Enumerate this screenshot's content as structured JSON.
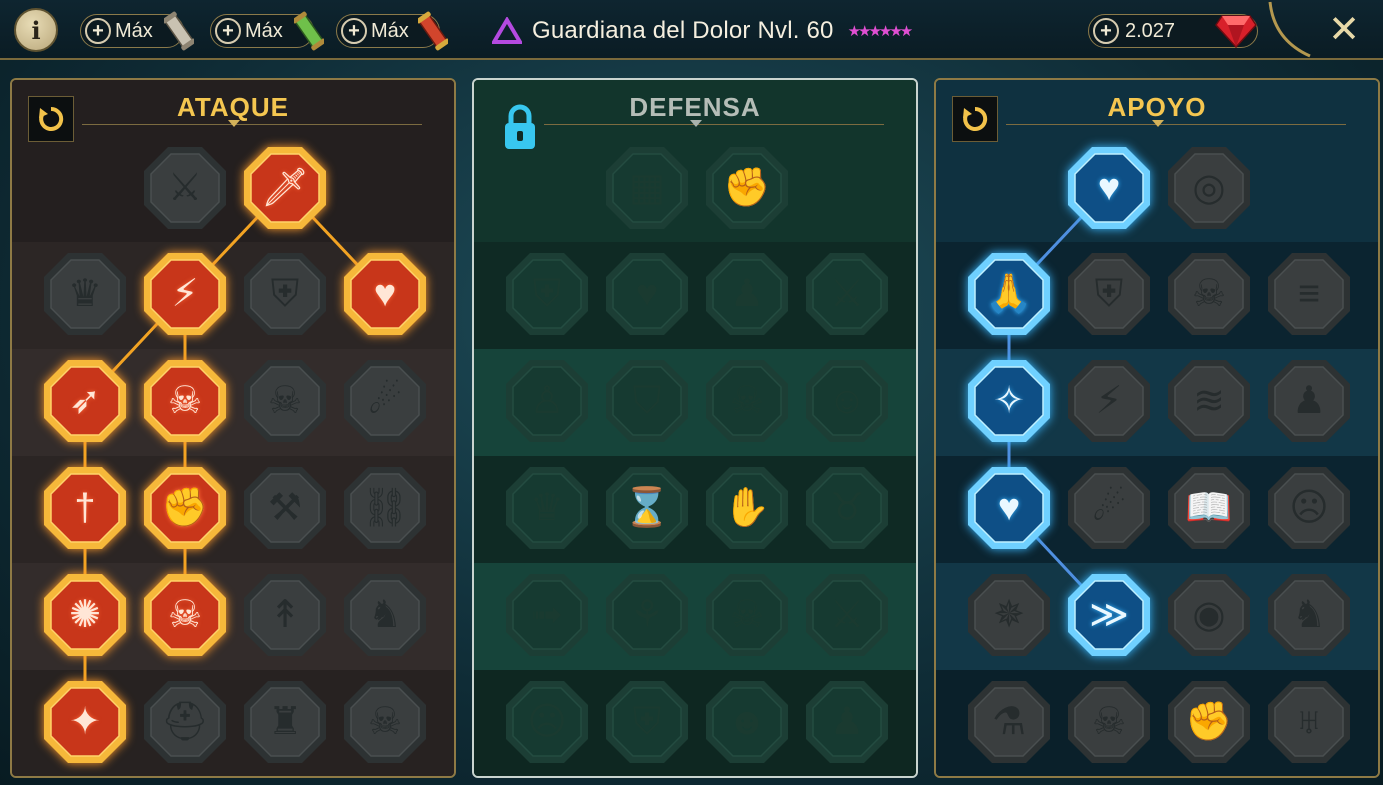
{
  "topbar": {
    "info_label": "i",
    "resources": [
      {
        "label": "Máx",
        "icon": "silver-scroll-icon"
      },
      {
        "label": "Máx",
        "icon": "green-scroll-icon"
      },
      {
        "label": "Máx",
        "icon": "red-scroll-icon"
      }
    ],
    "title": "Guardiana del Dolor Nvl. 60",
    "stars": "★★★★★★",
    "gems": "2.027",
    "close_label": "✕"
  },
  "colors": {
    "attack_accent": "#f4c650",
    "attack_active": "#d0401e",
    "support_active": "#1a8fd6",
    "stars": "#e04fd2"
  },
  "panels": {
    "attack": {
      "title": "ATAQUE",
      "nodes": [
        {
          "row": 0,
          "col": 1,
          "state": "dim",
          "glyph": "⚔",
          "icon": "crossed-swords-icon"
        },
        {
          "row": 0,
          "col": 2,
          "state": "active",
          "glyph": "🗡",
          "icon": "blade-strike-icon"
        },
        {
          "row": 1,
          "col": 0,
          "state": "dim",
          "glyph": "♛",
          "icon": "horned-demon-icon"
        },
        {
          "row": 1,
          "col": 1,
          "state": "active",
          "glyph": "⚡",
          "icon": "slash-wave-icon"
        },
        {
          "row": 1,
          "col": 2,
          "state": "dim",
          "glyph": "⛨",
          "icon": "shield-break-icon"
        },
        {
          "row": 1,
          "col": 3,
          "state": "active",
          "glyph": "♥",
          "icon": "bleeding-heart-icon"
        },
        {
          "row": 2,
          "col": 0,
          "state": "active",
          "glyph": "➶",
          "icon": "pierced-arm-icon"
        },
        {
          "row": 2,
          "col": 1,
          "state": "active",
          "glyph": "☠",
          "icon": "fanged-mouth-icon"
        },
        {
          "row": 2,
          "col": 2,
          "state": "dim",
          "glyph": "☠",
          "icon": "skull-wind-icon"
        },
        {
          "row": 2,
          "col": 3,
          "state": "dim",
          "glyph": "☄",
          "icon": "scythe-icon"
        },
        {
          "row": 3,
          "col": 0,
          "state": "active",
          "glyph": "†",
          "icon": "sword-heart-icon"
        },
        {
          "row": 3,
          "col": 1,
          "state": "active",
          "glyph": "✊",
          "icon": "fist-blade-icon"
        },
        {
          "row": 3,
          "col": 2,
          "state": "dim",
          "glyph": "⚒",
          "icon": "axe-icon"
        },
        {
          "row": 3,
          "col": 3,
          "state": "dim",
          "glyph": "⛓",
          "icon": "chain-lightning-icon"
        },
        {
          "row": 4,
          "col": 0,
          "state": "active",
          "glyph": "✺",
          "icon": "arrow-burst-icon"
        },
        {
          "row": 4,
          "col": 1,
          "state": "active",
          "glyph": "☠",
          "icon": "triple-skull-icon"
        },
        {
          "row": 4,
          "col": 2,
          "state": "dim",
          "glyph": "↟",
          "icon": "dagger-ring-icon"
        },
        {
          "row": 4,
          "col": 3,
          "state": "dim",
          "glyph": "♞",
          "icon": "raging-warrior-icon"
        },
        {
          "row": 5,
          "col": 0,
          "state": "active",
          "glyph": "✦",
          "icon": "sword-sparkle-icon"
        },
        {
          "row": 5,
          "col": 1,
          "state": "dim",
          "glyph": "⛑",
          "icon": "knight-helm-icon"
        },
        {
          "row": 5,
          "col": 2,
          "state": "dim",
          "glyph": "♜",
          "icon": "horned-beast-icon"
        },
        {
          "row": 5,
          "col": 3,
          "state": "dim",
          "glyph": "☠",
          "icon": "skull-sword-icon"
        }
      ]
    },
    "defense": {
      "title": "DEFENSA",
      "nodes": [
        {
          "row": 0,
          "col": 1,
          "state": "dim",
          "glyph": "▦",
          "icon": "armor-plates-icon"
        },
        {
          "row": 0,
          "col": 2,
          "state": "dim",
          "glyph": "✊",
          "icon": "raised-fist-icon"
        },
        {
          "row": 1,
          "col": 0,
          "state": "dim",
          "glyph": "⛨",
          "icon": "chest-shield-icon"
        },
        {
          "row": 1,
          "col": 1,
          "state": "dim",
          "glyph": "♥",
          "icon": "heart-arrow-icon"
        },
        {
          "row": 1,
          "col": 2,
          "state": "dim",
          "glyph": "♟",
          "icon": "muscled-body-icon"
        },
        {
          "row": 1,
          "col": 3,
          "state": "dim",
          "glyph": "⚔",
          "icon": "crossed-blades-icon"
        },
        {
          "row": 2,
          "col": 0,
          "state": "dim",
          "glyph": "♙",
          "icon": "dodging-figure-icon"
        },
        {
          "row": 2,
          "col": 1,
          "state": "dim",
          "glyph": "⛉",
          "icon": "shield-figure-icon"
        },
        {
          "row": 2,
          "col": 2,
          "state": "dim",
          "glyph": "☠",
          "icon": "skull-heart-icon"
        },
        {
          "row": 2,
          "col": 3,
          "state": "dim",
          "glyph": "☺",
          "icon": "hooded-face-icon"
        },
        {
          "row": 3,
          "col": 0,
          "state": "dim",
          "glyph": "♛",
          "icon": "group-figures-icon"
        },
        {
          "row": 3,
          "col": 1,
          "state": "dim",
          "glyph": "⌛",
          "icon": "hourglass-icon"
        },
        {
          "row": 3,
          "col": 2,
          "state": "dim",
          "glyph": "✋",
          "icon": "open-hand-icon"
        },
        {
          "row": 3,
          "col": 3,
          "state": "dim",
          "glyph": "♉",
          "icon": "bull-head-icon"
        },
        {
          "row": 4,
          "col": 0,
          "state": "dim",
          "glyph": "➟",
          "icon": "dashing-figure-icon"
        },
        {
          "row": 4,
          "col": 1,
          "state": "dim",
          "glyph": "⚘",
          "icon": "claws-icon"
        },
        {
          "row": 4,
          "col": 2,
          "state": "dim",
          "glyph": "☠",
          "icon": "crowned-skull-icon"
        },
        {
          "row": 4,
          "col": 3,
          "state": "dim",
          "glyph": "⚔",
          "icon": "blocking-arm-icon"
        },
        {
          "row": 5,
          "col": 0,
          "state": "dim",
          "glyph": "☹",
          "icon": "angry-face-icon"
        },
        {
          "row": 5,
          "col": 1,
          "state": "dim",
          "glyph": "⛨",
          "icon": "winged-shield-icon"
        },
        {
          "row": 5,
          "col": 2,
          "state": "dim",
          "glyph": "☻",
          "icon": "bald-face-icon"
        },
        {
          "row": 5,
          "col": 3,
          "state": "dim",
          "glyph": "♟",
          "icon": "strongman-icon"
        }
      ]
    },
    "support": {
      "title": "APOYO",
      "nodes": [
        {
          "row": 0,
          "col": 1,
          "state": "active",
          "glyph": "♥",
          "icon": "heart-heal-icon"
        },
        {
          "row": 0,
          "col": 2,
          "state": "dim",
          "glyph": "◎",
          "icon": "swirl-icon"
        },
        {
          "row": 1,
          "col": 0,
          "state": "active",
          "glyph": "🙏",
          "icon": "praying-hands-icon"
        },
        {
          "row": 1,
          "col": 1,
          "state": "dim",
          "glyph": "⛨",
          "icon": "aura-shield-icon"
        },
        {
          "row": 1,
          "col": 2,
          "state": "dim",
          "glyph": "☠",
          "icon": "flaming-skull-icon"
        },
        {
          "row": 1,
          "col": 3,
          "state": "dim",
          "glyph": "≡",
          "icon": "speed-lines-icon"
        },
        {
          "row": 2,
          "col": 0,
          "state": "active",
          "glyph": "✧",
          "icon": "blessed-figure-icon"
        },
        {
          "row": 2,
          "col": 1,
          "state": "dim",
          "glyph": "⚡",
          "icon": "lightning-icon"
        },
        {
          "row": 2,
          "col": 2,
          "state": "dim",
          "glyph": "≋",
          "icon": "shatter-icon"
        },
        {
          "row": 2,
          "col": 3,
          "state": "dim",
          "glyph": "♟",
          "icon": "twin-figures-icon"
        },
        {
          "row": 3,
          "col": 0,
          "state": "active",
          "glyph": "♥",
          "icon": "chained-heart-icon"
        },
        {
          "row": 3,
          "col": 1,
          "state": "dim",
          "glyph": "☄",
          "icon": "comet-icon"
        },
        {
          "row": 3,
          "col": 2,
          "state": "dim",
          "glyph": "📖",
          "icon": "open-book-icon"
        },
        {
          "row": 3,
          "col": 3,
          "state": "dim",
          "glyph": "☹",
          "icon": "glaring-face-icon"
        },
        {
          "row": 4,
          "col": 0,
          "state": "dim",
          "glyph": "✵",
          "icon": "compass-star-icon"
        },
        {
          "row": 4,
          "col": 1,
          "state": "active",
          "glyph": "≫",
          "icon": "swift-boot-icon"
        },
        {
          "row": 4,
          "col": 2,
          "state": "dim",
          "glyph": "◉",
          "icon": "eye-icon"
        },
        {
          "row": 4,
          "col": 3,
          "state": "dim",
          "glyph": "♞",
          "icon": "kicking-figure-icon"
        },
        {
          "row": 5,
          "col": 0,
          "state": "dim",
          "glyph": "⚗",
          "icon": "potion-icon"
        },
        {
          "row": 5,
          "col": 1,
          "state": "dim",
          "glyph": "☠",
          "icon": "skull-icon"
        },
        {
          "row": 5,
          "col": 2,
          "state": "dim",
          "glyph": "✊",
          "icon": "grip-fist-icon"
        },
        {
          "row": 5,
          "col": 3,
          "state": "dim",
          "glyph": "♅",
          "icon": "eagle-icon"
        }
      ]
    }
  }
}
